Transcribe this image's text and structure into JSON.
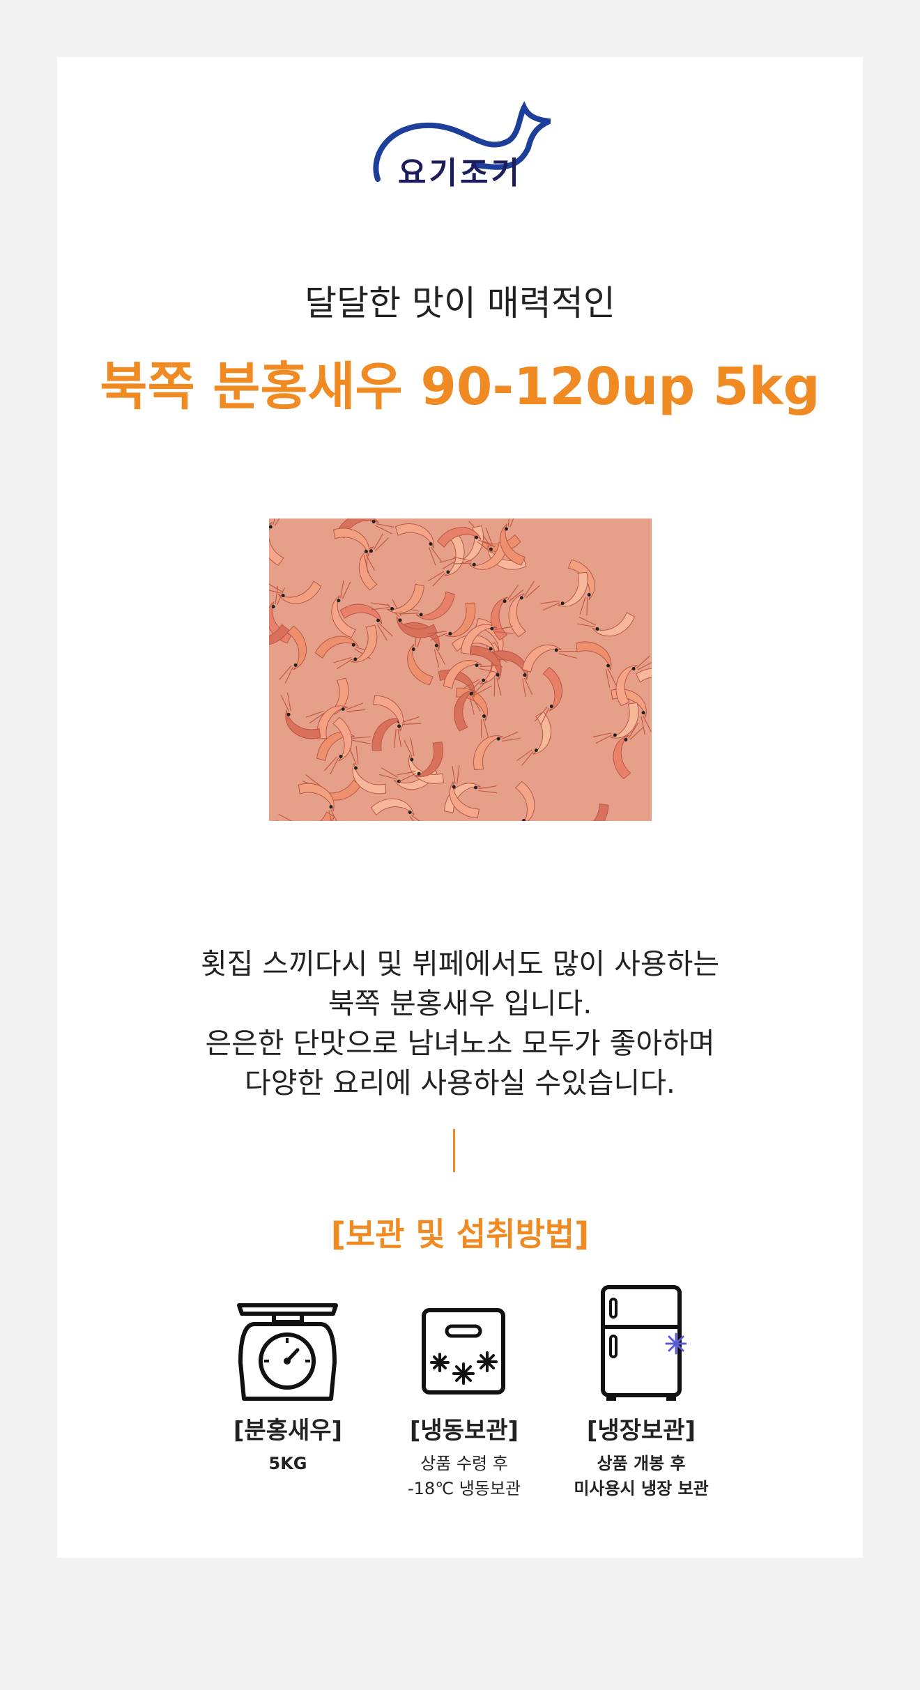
{
  "brand": {
    "logo_text": "요기조기"
  },
  "header": {
    "subtitle": "달달한 맛이 매력적인",
    "title": "북쪽 분홍새우 90-120up 5kg"
  },
  "description": {
    "lines": [
      "횟집 스끼다시 및 뷔페에서도 많이 사용하는",
      "북쪽 분홍새우 입니다.",
      "은은한 단맛으로 남녀노소 모두가 좋아하며",
      "다양한 요리에 사용하실 수있습니다."
    ]
  },
  "storage": {
    "title": "[보관 및 섭취방법]",
    "items": [
      {
        "icon": "scale-icon",
        "label": "[분홍새우]",
        "note_lines": [
          "5KG"
        ]
      },
      {
        "icon": "freezer-box-icon",
        "label": "[냉동보관]",
        "note_lines": [
          "상품 수령 후",
          "-18℃ 냉동보관"
        ]
      },
      {
        "icon": "refrigerator-icon",
        "label": "[냉장보관]",
        "note_lines": [
          "상품 개봉 후",
          "미사용시 냉장 보관"
        ]
      }
    ]
  },
  "colors": {
    "accent": "#f08a22",
    "brand_blue": "#1d3f99",
    "text": "#222222",
    "background": "#f2f2f2"
  }
}
